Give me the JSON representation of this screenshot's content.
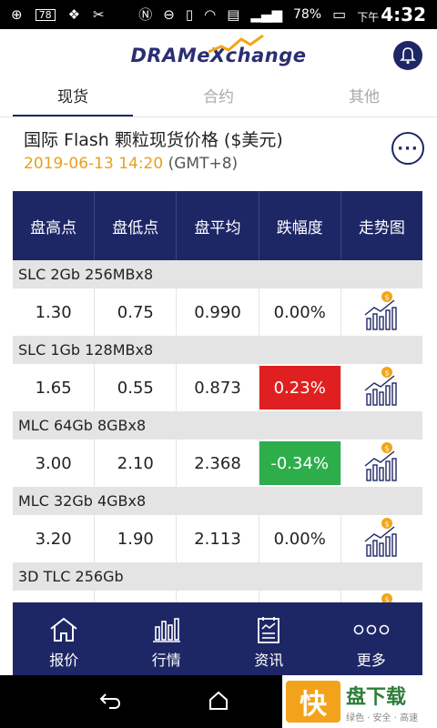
{
  "status": {
    "notif_count": "78",
    "battery": "78%",
    "ampm": "下午",
    "time": "4:32"
  },
  "header": {
    "logo": "DRAMeXchange"
  },
  "tabs": [
    {
      "label": "现货"
    },
    {
      "label": "合约"
    },
    {
      "label": "其他"
    }
  ],
  "heading": {
    "title": "国际 Flash 颗粒现货价格 ($美元)",
    "date": "2019-06-13 14:20",
    "tz": "(GMT+8)"
  },
  "columns": [
    "盘高点",
    "盘低点",
    "盘平均",
    "跌幅度",
    "走势图"
  ],
  "rows": [
    {
      "name": "SLC 2Gb 256MBx8",
      "high": "1.30",
      "low": "0.75",
      "avg": "0.990",
      "change": "0.00%",
      "trend": "neutral"
    },
    {
      "name": "SLC 1Gb 128MBx8",
      "high": "1.65",
      "low": "0.55",
      "avg": "0.873",
      "change": "0.23%",
      "trend": "up"
    },
    {
      "name": "MLC 64Gb 8GBx8",
      "high": "3.00",
      "low": "2.10",
      "avg": "2.368",
      "change": "-0.34%",
      "trend": "down"
    },
    {
      "name": "MLC 32Gb 4GBx8",
      "high": "3.20",
      "low": "1.90",
      "avg": "2.113",
      "change": "0.00%",
      "trend": "neutral"
    },
    {
      "name": "3D TLC  256Gb",
      "high": "",
      "low": "",
      "avg": "",
      "change": "",
      "trend": "neutral"
    }
  ],
  "bottom_nav": [
    {
      "label": "报价",
      "icon": "home-icon"
    },
    {
      "label": "行情",
      "icon": "bar-chart-icon"
    },
    {
      "label": "资讯",
      "icon": "news-icon"
    },
    {
      "label": "更多",
      "icon": "more-dots-icon"
    }
  ],
  "watermark": {
    "logo_char": "快",
    "title": "盘下载",
    "slogan": "绿色 · 安全 · 高速"
  },
  "colors": {
    "primary": "#1e2766",
    "up": "#e02020",
    "down": "#2dae4b",
    "date": "#e8a11a"
  }
}
